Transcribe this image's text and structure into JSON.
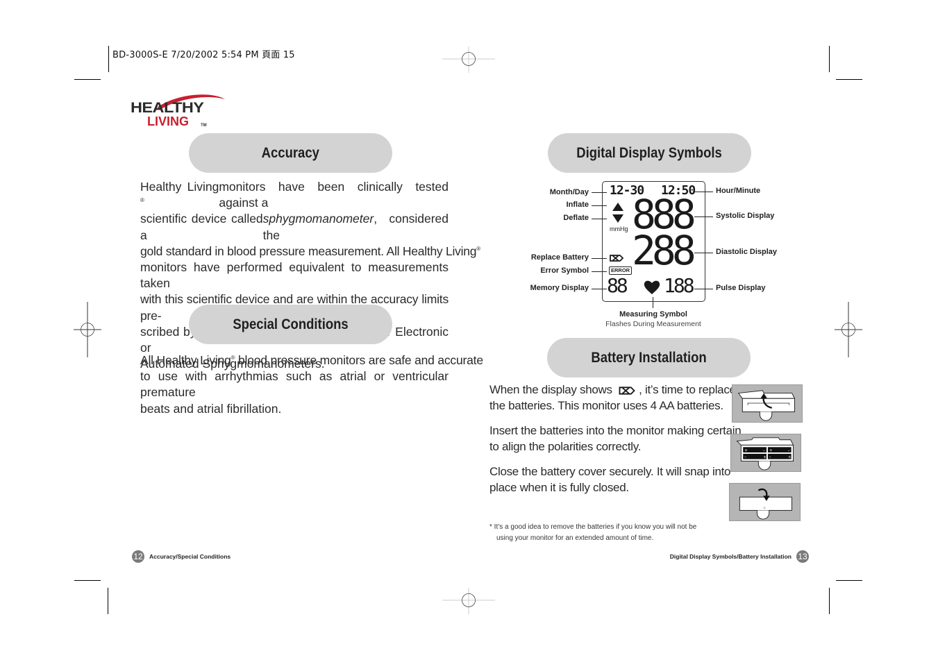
{
  "print_slug": "BD-3000S-E  7/20/2002  5:54 PM  頁面 15",
  "logo": {
    "line1": "HEALTHY",
    "line2": "LIVING",
    "tm": "TM",
    "brand_red": "#c8202f"
  },
  "left_page": {
    "accuracy": {
      "heading": "Accuracy",
      "lines": [
        [
          "Healthy Living",
          "®",
          " monitors have been clinically tested against a"
        ],
        [
          "scientific device called a ",
          "sphygmomanometer",
          ", considered the"
        ],
        [
          "gold standard in blood pressure measurement. All Healthy Living",
          "®",
          ""
        ],
        [
          "monitors have performed equivalent to measurements taken"
        ],
        [
          "with this scientific device and are within the accuracy limits pre-"
        ],
        [
          "scribed by the American National Standard for Electronic or"
        ],
        [
          "Automated Sphygmomanometers."
        ]
      ]
    },
    "special_conditions": {
      "heading": "Special Conditions",
      "line1a": "All Healthy Living",
      "line1reg": "®",
      "line1b": " blood pressure monitors are safe and accurate",
      "line2": "to use with arrhythmias such as atrial or ventricular premature",
      "line3": "beats and atrial fibrillation."
    },
    "footer": {
      "page_number": "12",
      "title": "Accuracy/Special Conditions"
    }
  },
  "right_page": {
    "display_symbols": {
      "heading": "Digital Display Symbols",
      "lcd": {
        "month_day": "12-30",
        "hour_minute": "12:50",
        "systolic": "888",
        "diastolic": "288",
        "unit": "mmHg",
        "error": "ERROR",
        "memory": "88",
        "pulse": "188"
      },
      "labels_left": [
        "Month/Day",
        "Inflate",
        "Deflate",
        "Replace Battery",
        "Error Symbol",
        "Memory Display"
      ],
      "labels_right": [
        "Hour/Minute",
        "Systolic Display",
        "Diastolic Display",
        "Pulse Display"
      ],
      "measuring_label": "Measuring Symbol",
      "measuring_sub": "Flashes During Measurement"
    },
    "battery": {
      "heading": "Battery Installation",
      "p1a": "When the display shows",
      "p1b": ", it’s time to replace",
      "p1c": "the batteries. This monitor uses 4 AA batteries.",
      "p2a": "Insert the batteries into the monitor making certain",
      "p2b": "to align the polarities correctly.",
      "p3a": "Close the battery cover securely. It will snap into",
      "p3b": "place when it is fully closed.",
      "note_a": "*  It’s a good idea to remove the batteries if you know you will not be",
      "note_b": "using your monitor for an extended amount of time."
    },
    "footer": {
      "page_number": "13",
      "title": "Digital Display Symbols/Battery Installation"
    }
  }
}
